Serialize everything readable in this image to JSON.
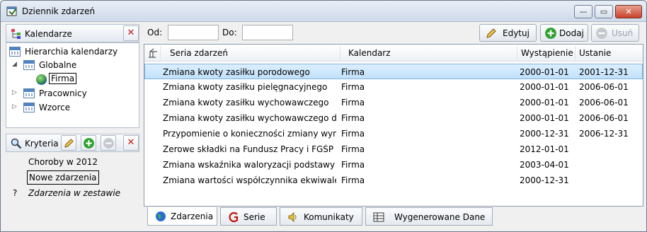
{
  "window": {
    "title": "Dziennik zdarzeń"
  },
  "window_buttons": {
    "minimize": "—",
    "maximize": "▭",
    "close": "✕"
  },
  "calendars_panel": {
    "title": "Kalendarze",
    "tree": {
      "root": "Hierarchia kalendarzy",
      "globalne": "Globalne",
      "firma": "Firma",
      "pracownicy": "Pracownicy",
      "wzorce": "Wzorce"
    }
  },
  "criteria_panel": {
    "title": "Kryteria",
    "items": [
      "Choroby w 2012",
      "Nowe zdarzenia"
    ],
    "footer_marker": "?",
    "footer_text": "Zdarzenia w zestawie"
  },
  "filter": {
    "from_label": "Od:",
    "to_label": "Do:",
    "from_value": "",
    "to_value": ""
  },
  "toolbar": {
    "edit": "Edytuj",
    "add": "Dodaj",
    "remove": "Usuń"
  },
  "grid": {
    "headers": {
      "series": "Seria zdarzeń",
      "calendar": "Kalendarz",
      "occurrence": "Wystąpienie",
      "cancellation": "Ustanie"
    },
    "rows": [
      {
        "series": "Zmiana kwoty zasiłku porodowego",
        "calendar": "Firma",
        "occurrence": "2000-01-01",
        "cancellation": "2001-12-31"
      },
      {
        "series": "Zmiana kwoty zasiłku pielęgnacyjnego",
        "calendar": "Firma",
        "occurrence": "2000-01-01",
        "cancellation": "2006-06-01"
      },
      {
        "series": "Zmiana kwoty zasiłku wychowawczego",
        "calendar": "Firma",
        "occurrence": "2000-01-01",
        "cancellation": "2006-06-01"
      },
      {
        "series": "Zmiana kwoty zasiłku wychowawczego dla s...",
        "calendar": "Firma",
        "occurrence": "2000-01-01",
        "cancellation": "2006-06-01"
      },
      {
        "series": "Przypomienie o konieczności zmiany wymiar...",
        "calendar": "Firma",
        "occurrence": "2000-12-31",
        "cancellation": "2006-12-31"
      },
      {
        "series": "Zerowe składki na Fundusz Pracy i FGŚP",
        "calendar": "Firma",
        "occurrence": "2012-01-01",
        "cancellation": ""
      },
      {
        "series": "Zmiana wskaźnika waloryzacji podstawy wy...",
        "calendar": "Firma",
        "occurrence": "2003-04-01",
        "cancellation": ""
      },
      {
        "series": "Zmiana wartości współczynnika ekwiwalentu...",
        "calendar": "Firma",
        "occurrence": "2000-12-31",
        "cancellation": ""
      }
    ]
  },
  "tabs": [
    "Zdarzenia",
    "Serie",
    "Komunikaty",
    "Wygenerowane Dane"
  ],
  "colors": {
    "selection": "#c2e1fb",
    "delete_red": "#c4130e",
    "add_green": "#2fa12f"
  }
}
